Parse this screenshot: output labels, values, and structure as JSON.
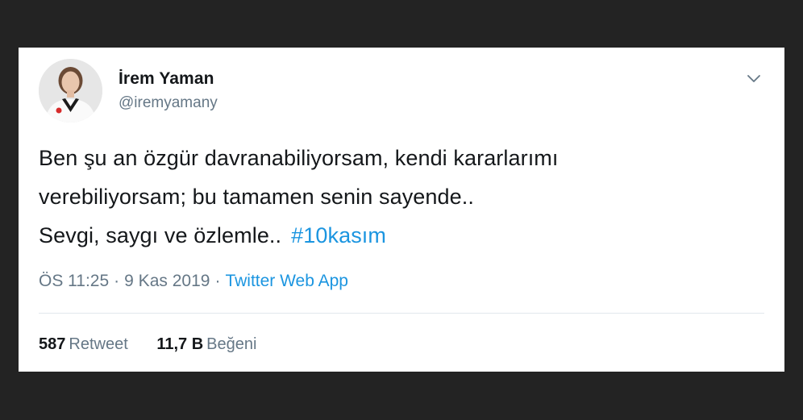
{
  "tweet": {
    "author_name": "İrem Yaman",
    "author_handle": "@iremyamany",
    "text_lines": [
      "Ben şu an özgür davranabiliyorsam, kendi kararlarımı",
      "verebiliyorsam; bu tamamen senin sayende..",
      "Sevgi, saygı ve özlemle.."
    ],
    "hashtag": "#10kasım",
    "time": "ÖS 11:25",
    "separator": "·",
    "date": "9 Kas 2019",
    "source": "Twitter Web App",
    "stats": {
      "retweets_count": "587",
      "retweets_label": "Retweet",
      "likes_count": "11,7 B",
      "likes_label": "Beğeni"
    }
  },
  "icons": {
    "menu": "chevron-down-icon",
    "avatar": "avatar"
  },
  "colors": {
    "background": "#232323",
    "card": "#ffffff",
    "text": "#14171a",
    "muted": "#657786",
    "link": "#1b95e0",
    "divider": "#e1e8ed"
  }
}
